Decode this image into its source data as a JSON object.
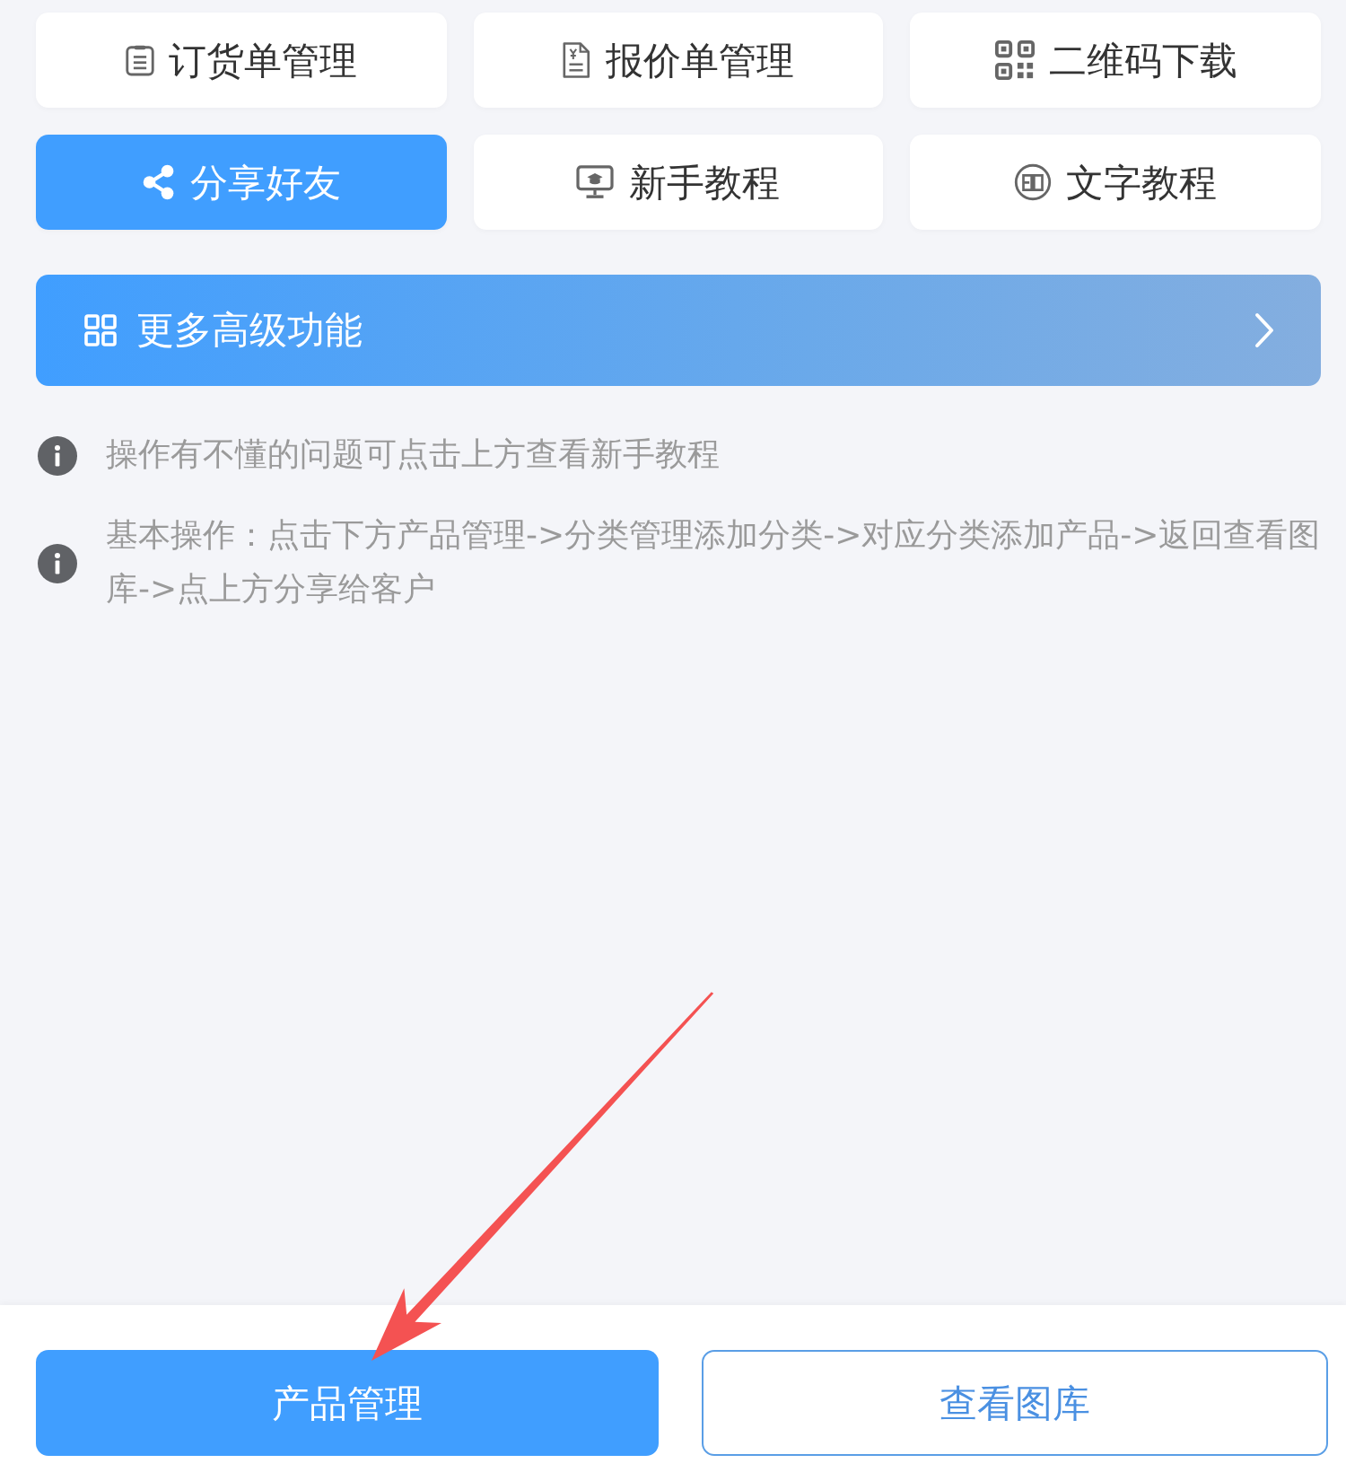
{
  "tiles": [
    {
      "label": "订货单管理",
      "selected": false
    },
    {
      "label": "报价单管理",
      "selected": false
    },
    {
      "label": "二维码下载",
      "selected": false
    },
    {
      "label": "分享好友",
      "selected": true
    },
    {
      "label": "新手教程",
      "selected": false
    },
    {
      "label": "文字教程",
      "selected": false
    }
  ],
  "banner": {
    "label": "更多高级功能"
  },
  "tips": [
    "操作有不懂的问题可点击上方查看新手教程",
    "基本操作：点击下方产品管理->分类管理添加分类->对应分类添加产品->返回查看图库->点上方分享给客户"
  ],
  "bottom_buttons": [
    {
      "label": "产品管理",
      "kind": "primary"
    },
    {
      "label": "查看图库",
      "kind": "outline"
    }
  ]
}
